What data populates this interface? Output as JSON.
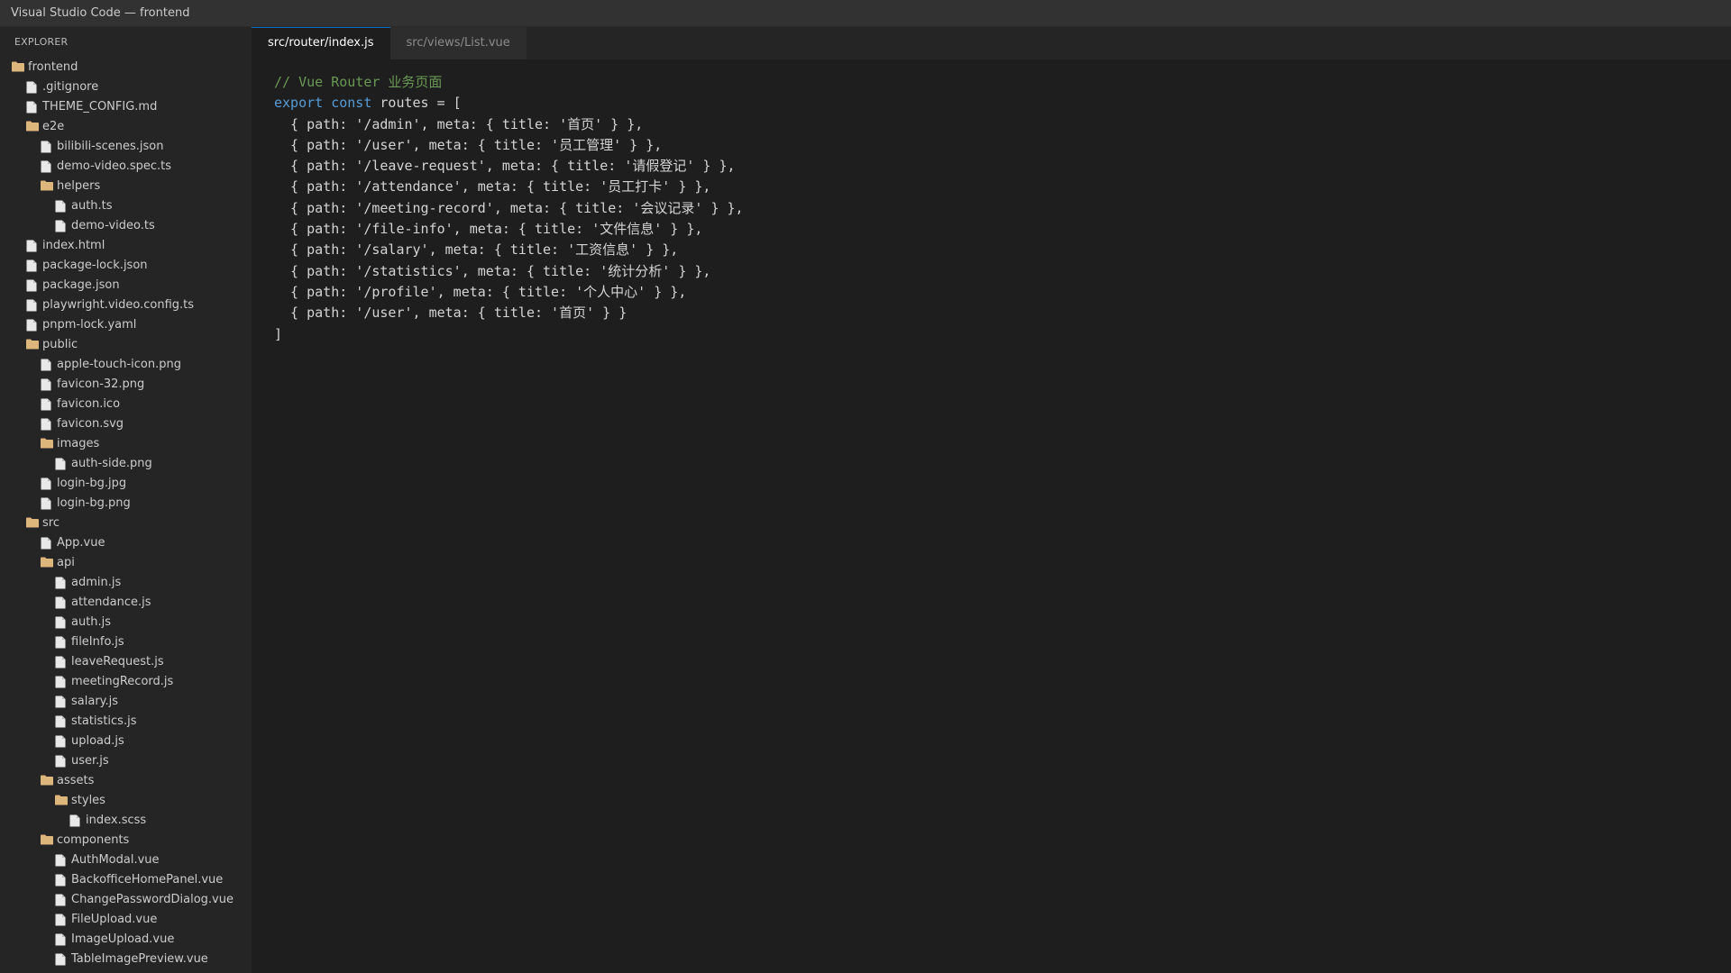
{
  "window": {
    "title": "Visual Studio Code — frontend"
  },
  "sidebar": {
    "header": "EXPLORER",
    "tree": [
      {
        "label": "frontend",
        "type": "folder",
        "depth": 0
      },
      {
        "label": ".gitignore",
        "type": "file",
        "depth": 1
      },
      {
        "label": "THEME_CONFIG.md",
        "type": "file",
        "depth": 1
      },
      {
        "label": "e2e",
        "type": "folder",
        "depth": 1
      },
      {
        "label": "bilibili-scenes.json",
        "type": "file",
        "depth": 2
      },
      {
        "label": "demo-video.spec.ts",
        "type": "file",
        "depth": 2
      },
      {
        "label": "helpers",
        "type": "folder",
        "depth": 2
      },
      {
        "label": "auth.ts",
        "type": "file",
        "depth": 3
      },
      {
        "label": "demo-video.ts",
        "type": "file",
        "depth": 3
      },
      {
        "label": "index.html",
        "type": "file",
        "depth": 1
      },
      {
        "label": "package-lock.json",
        "type": "file",
        "depth": 1
      },
      {
        "label": "package.json",
        "type": "file",
        "depth": 1
      },
      {
        "label": "playwright.video.config.ts",
        "type": "file",
        "depth": 1
      },
      {
        "label": "pnpm-lock.yaml",
        "type": "file",
        "depth": 1
      },
      {
        "label": "public",
        "type": "folder",
        "depth": 1
      },
      {
        "label": "apple-touch-icon.png",
        "type": "file",
        "depth": 2
      },
      {
        "label": "favicon-32.png",
        "type": "file",
        "depth": 2
      },
      {
        "label": "favicon.ico",
        "type": "file",
        "depth": 2
      },
      {
        "label": "favicon.svg",
        "type": "file",
        "depth": 2
      },
      {
        "label": "images",
        "type": "folder",
        "depth": 2
      },
      {
        "label": "auth-side.png",
        "type": "file",
        "depth": 3
      },
      {
        "label": "login-bg.jpg",
        "type": "file",
        "depth": 2
      },
      {
        "label": "login-bg.png",
        "type": "file",
        "depth": 2
      },
      {
        "label": "src",
        "type": "folder",
        "depth": 1
      },
      {
        "label": "App.vue",
        "type": "file",
        "depth": 2
      },
      {
        "label": "api",
        "type": "folder",
        "depth": 2
      },
      {
        "label": "admin.js",
        "type": "file",
        "depth": 3
      },
      {
        "label": "attendance.js",
        "type": "file",
        "depth": 3
      },
      {
        "label": "auth.js",
        "type": "file",
        "depth": 3
      },
      {
        "label": "fileInfo.js",
        "type": "file",
        "depth": 3
      },
      {
        "label": "leaveRequest.js",
        "type": "file",
        "depth": 3
      },
      {
        "label": "meetingRecord.js",
        "type": "file",
        "depth": 3
      },
      {
        "label": "salary.js",
        "type": "file",
        "depth": 3
      },
      {
        "label": "statistics.js",
        "type": "file",
        "depth": 3
      },
      {
        "label": "upload.js",
        "type": "file",
        "depth": 3
      },
      {
        "label": "user.js",
        "type": "file",
        "depth": 3
      },
      {
        "label": "assets",
        "type": "folder",
        "depth": 2
      },
      {
        "label": "styles",
        "type": "folder",
        "depth": 3
      },
      {
        "label": "index.scss",
        "type": "file",
        "depth": 4
      },
      {
        "label": "components",
        "type": "folder",
        "depth": 2
      },
      {
        "label": "AuthModal.vue",
        "type": "file",
        "depth": 3
      },
      {
        "label": "BackofficeHomePanel.vue",
        "type": "file",
        "depth": 3
      },
      {
        "label": "ChangePasswordDialog.vue",
        "type": "file",
        "depth": 3
      },
      {
        "label": "FileUpload.vue",
        "type": "file",
        "depth": 3
      },
      {
        "label": "ImageUpload.vue",
        "type": "file",
        "depth": 3
      },
      {
        "label": "TableImagePreview.vue",
        "type": "file",
        "depth": 3
      }
    ]
  },
  "tabs": [
    {
      "label": "src/router/index.js",
      "active": true
    },
    {
      "label": "src/views/List.vue",
      "active": false
    }
  ],
  "editor": {
    "lines": [
      [
        {
          "t": "// Vue Router 业务页面",
          "k": "comment"
        }
      ],
      [
        {
          "t": "export",
          "k": "keyword"
        },
        {
          "t": " ",
          "k": "plain"
        },
        {
          "t": "const",
          "k": "keyword"
        },
        {
          "t": " routes = [",
          "k": "plain"
        }
      ],
      [
        {
          "t": "  { path: '/admin', meta: { title: '首页' } },",
          "k": "plain"
        }
      ],
      [
        {
          "t": "  { path: '/user', meta: { title: '员工管理' } },",
          "k": "plain"
        }
      ],
      [
        {
          "t": "  { path: '/leave-request', meta: { title: '请假登记' } },",
          "k": "plain"
        }
      ],
      [
        {
          "t": "  { path: '/attendance', meta: { title: '员工打卡' } },",
          "k": "plain"
        }
      ],
      [
        {
          "t": "  { path: '/meeting-record', meta: { title: '会议记录' } },",
          "k": "plain"
        }
      ],
      [
        {
          "t": "  { path: '/file-info', meta: { title: '文件信息' } },",
          "k": "plain"
        }
      ],
      [
        {
          "t": "  { path: '/salary', meta: { title: '工资信息' } },",
          "k": "plain"
        }
      ],
      [
        {
          "t": "  { path: '/statistics', meta: { title: '统计分析' } },",
          "k": "plain"
        }
      ],
      [
        {
          "t": "  { path: '/profile', meta: { title: '个人中心' } },",
          "k": "plain"
        }
      ],
      [
        {
          "t": "  { path: '/user', meta: { title: '首页' } }",
          "k": "plain"
        }
      ],
      [
        {
          "t": "]",
          "k": "plain"
        }
      ]
    ]
  },
  "colors": {
    "folder_icon": "#dcb67a",
    "file_icon": "#e8e8e8",
    "comment": "#6a9955",
    "keyword": "#569cd6",
    "accent": "#0e70c0"
  },
  "icons": {
    "folder": "folder-icon",
    "file": "file-icon"
  }
}
